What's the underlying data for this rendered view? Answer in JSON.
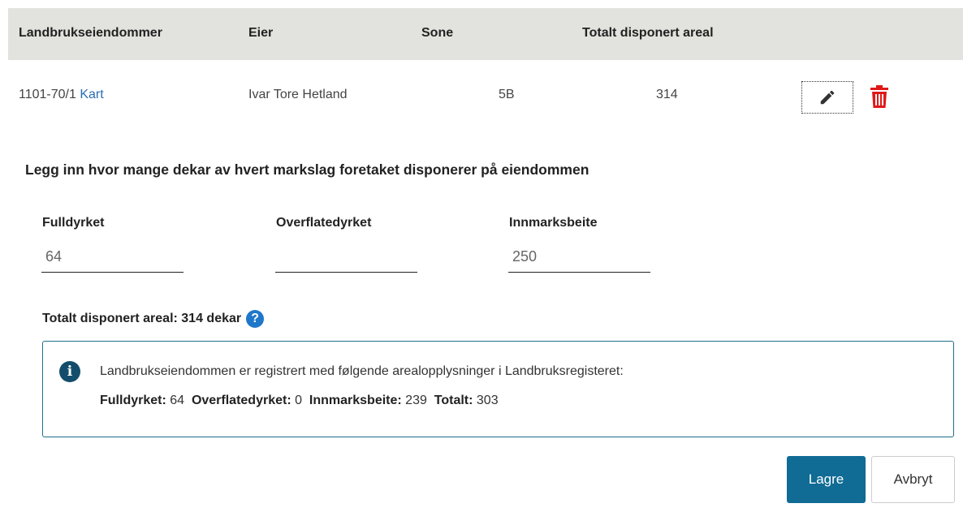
{
  "table": {
    "headers": [
      "Landbrukseiendommer",
      "Eier",
      "Sone",
      "Totalt disponert areal"
    ],
    "row": {
      "property": "1101-70/1",
      "map_link": "Kart",
      "owner": "Ivar Tore Hetland",
      "zone": "5B",
      "total_area": "314"
    },
    "actions": {
      "edit_icon": "pencil-icon",
      "delete_icon": "trash-icon",
      "delete_color": "#e01818"
    }
  },
  "form": {
    "instruction": "Legg inn hvor mange dekar av hvert markslag foretaket disponerer på eiendommen",
    "fields": [
      {
        "label": "Fulldyrket",
        "value": "64"
      },
      {
        "label": "Overflatedyrket",
        "value": ""
      },
      {
        "label": "Innmarksbeite",
        "value": "250"
      }
    ],
    "total_label": "Totalt disponert areal: 314 dekar",
    "help_icon": "question-circle-icon"
  },
  "info": {
    "icon": "info-circle-icon",
    "text": "Landbrukseiendommen er registrert med følgende arealopplysninger i Landbruksregisteret:",
    "stats": [
      {
        "label": "Fulldyrket:",
        "value": "64"
      },
      {
        "label": "Overflatedyrket:",
        "value": "0"
      },
      {
        "label": "Innmarksbeite:",
        "value": "239"
      },
      {
        "label": "Totalt:",
        "value": "303"
      }
    ],
    "border_color": "#1d6f8b"
  },
  "buttons": {
    "save": "Lagre",
    "cancel": "Avbryt",
    "save_color": "#106b95"
  }
}
